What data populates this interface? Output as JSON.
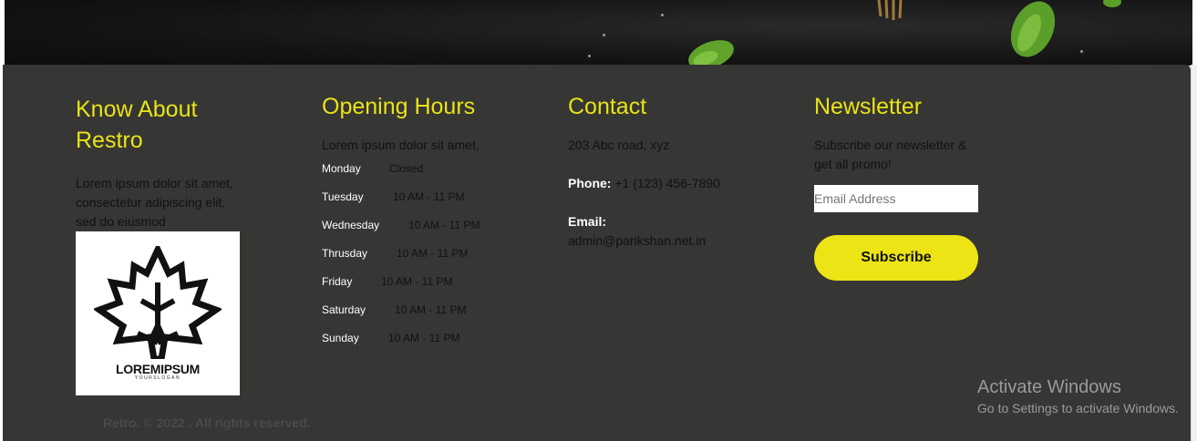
{
  "about": {
    "heading": "Know About Restro",
    "text": "Lorem ipsum dolor sit amet, consectetur adipiscing elit, sed do eiusmod",
    "logo": {
      "name": "LOREMIPSUM",
      "slogan": "YOURSLOGAN",
      "icon": "maple-leaf-icon"
    }
  },
  "hours": {
    "heading": "Opening Hours",
    "intro": "Lorem ipsum dolor sit amet,",
    "rows": [
      {
        "day": "Monday",
        "time": "Closed"
      },
      {
        "day": "Tuesday",
        "time": "10 AM - 11 PM"
      },
      {
        "day": "Wednesday",
        "time": "10 AM - 11 PM"
      },
      {
        "day": "Thrusday",
        "time": "10 AM - 11 PM"
      },
      {
        "day": "Friday",
        "time": "10 AM - 11 PM"
      },
      {
        "day": "Saturday",
        "time": "10 AM - 11 PM"
      },
      {
        "day": "Sunday",
        "time": "10 AM - 11 PM"
      }
    ]
  },
  "contact": {
    "heading": "Contact",
    "address": "203 Abc road, xyz",
    "phone_label": "Phone:",
    "phone": "+1 (123) 456-7890",
    "email_label": "Email:",
    "email": "admin@parikshan.net.in"
  },
  "newsletter": {
    "heading": "Newsletter",
    "text": "Subscribe our newsletter & get all promo!",
    "email_placeholder": "Email Address",
    "email_value": "",
    "subscribe_label": "Subscribe"
  },
  "footer": {
    "copyright": "Retro. © 2022 . All rights reserved."
  },
  "windows_watermark": {
    "title": "Activate Windows",
    "subtitle": "Go to Settings to activate Windows."
  },
  "colors": {
    "footer_bg": "#363634",
    "accent": "#e9e316",
    "button": "#ece414"
  }
}
